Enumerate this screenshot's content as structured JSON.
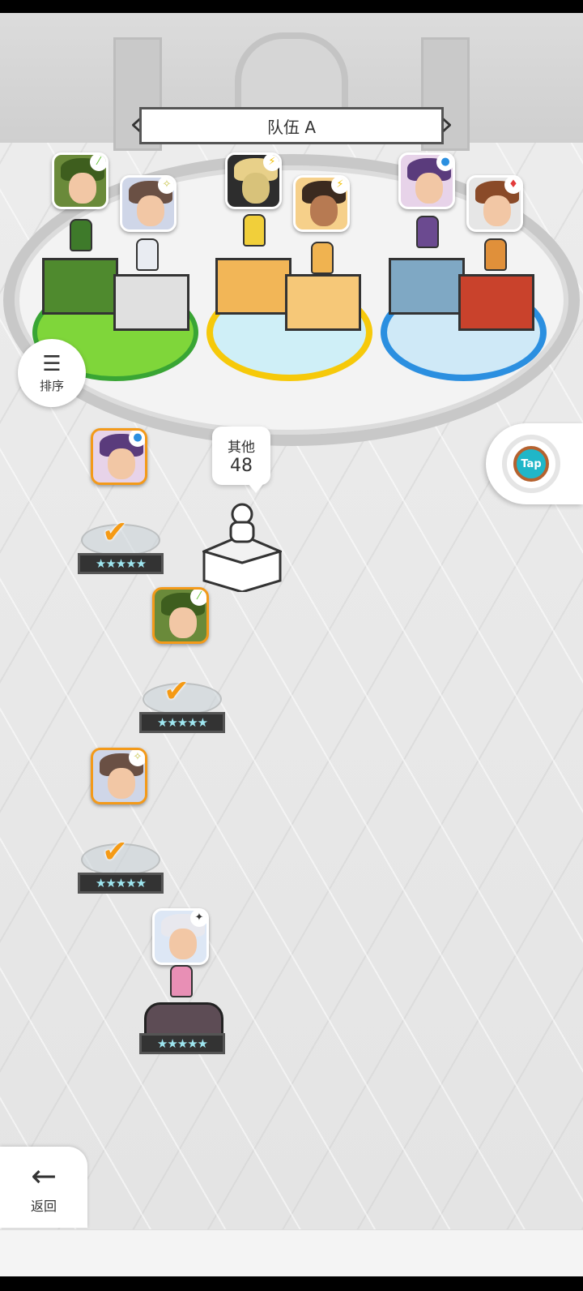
{
  "team": {
    "title": "队伍 A",
    "prev_icon": "chevron-left-icon",
    "next_icon": "chevron-right-icon"
  },
  "slots": [
    {
      "ring_color": "#7fd63a",
      "members": [
        {
          "portrait_bg": "#6a8a3a",
          "hair": "#3e5e1e",
          "element_badge": "leaf",
          "badge_glyph": "⁄",
          "badge_color": "#5bbf2a"
        },
        {
          "portrait_bg": "#cfd6e8",
          "hair": "#6a5044",
          "element_badge": "sparkle",
          "badge_glyph": "✧",
          "badge_color": "#c7c34a"
        }
      ]
    },
    {
      "ring_color": "#f6c90a",
      "members": [
        {
          "portrait_bg": "#2d2d2d",
          "hair": "#e8d089",
          "element_badge": "lightning",
          "badge_glyph": "⚡",
          "badge_color": "#f1c20c"
        },
        {
          "portrait_bg": "#f6d08a",
          "hair": "#3b2a1f",
          "element_badge": "lightning",
          "badge_glyph": "⚡",
          "badge_color": "#f1c20c"
        }
      ]
    },
    {
      "ring_color": "#2b8fe0",
      "members": [
        {
          "portrait_bg": "#e7d3e9",
          "hair": "#5a3b7c",
          "element_badge": "water",
          "badge_glyph": "●",
          "badge_color": "#2b8fe0"
        },
        {
          "portrait_bg": "#e6e6e6",
          "hair": "#8a4a28",
          "element_badge": "fire",
          "badge_glyph": "♦",
          "badge_color": "#e23b3b"
        }
      ]
    }
  ],
  "sort": {
    "label": "排序",
    "icon": "sort-icon"
  },
  "tap": {
    "label": "Tap"
  },
  "others": {
    "label": "其他",
    "count": "48"
  },
  "roster": [
    {
      "portrait_bg": "#e7d3e9",
      "hair": "#5a3b7c",
      "badge_glyph": "●",
      "badge_color": "#2b8fe0",
      "selected": true,
      "stars": "★★★★★"
    },
    {
      "portrait_bg": "#6a8a3a",
      "hair": "#3e5e1e",
      "badge_glyph": "⁄",
      "badge_color": "#5bbf2a",
      "selected": true,
      "stars": "★★★★★"
    },
    {
      "portrait_bg": "#cfd6e8",
      "hair": "#6a5044",
      "badge_glyph": "✧",
      "badge_color": "#c7c34a",
      "selected": true,
      "stars": "★★★★★"
    },
    {
      "portrait_bg": "#dde7f5",
      "hair": "#e8e8ee",
      "badge_glyph": "✦",
      "badge_color": "#333333",
      "selected": false,
      "stars": "★★★★★"
    }
  ],
  "back": {
    "label": "返回",
    "icon": "arrow-left-icon"
  }
}
